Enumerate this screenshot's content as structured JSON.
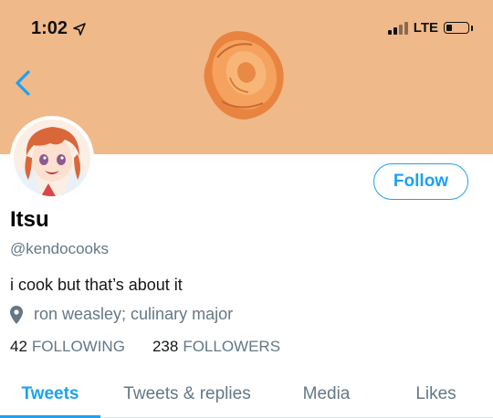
{
  "status_bar": {
    "time": "1:02",
    "network": "LTE"
  },
  "profile": {
    "name": "Itsu",
    "handle": "@kendocooks",
    "bio": "i cook but that’s about it",
    "location": "ron weasley; culinary major",
    "following_count": "42",
    "following_label": "FOLLOWING",
    "followers_count": "238",
    "followers_label": "FOLLOWERS"
  },
  "actions": {
    "follow_label": "Follow"
  },
  "tabs": [
    {
      "label": "Tweets",
      "active": true
    },
    {
      "label": "Tweets & replies",
      "active": false
    },
    {
      "label": "Media",
      "active": false
    },
    {
      "label": "Likes",
      "active": false
    }
  ],
  "colors": {
    "banner": "#f0b98a",
    "accent": "#1da1f2",
    "muted_text": "#657786"
  },
  "icons": {
    "back": "chevron-left-icon",
    "location": "map-pin-icon",
    "navigation": "location-arrow-icon"
  }
}
